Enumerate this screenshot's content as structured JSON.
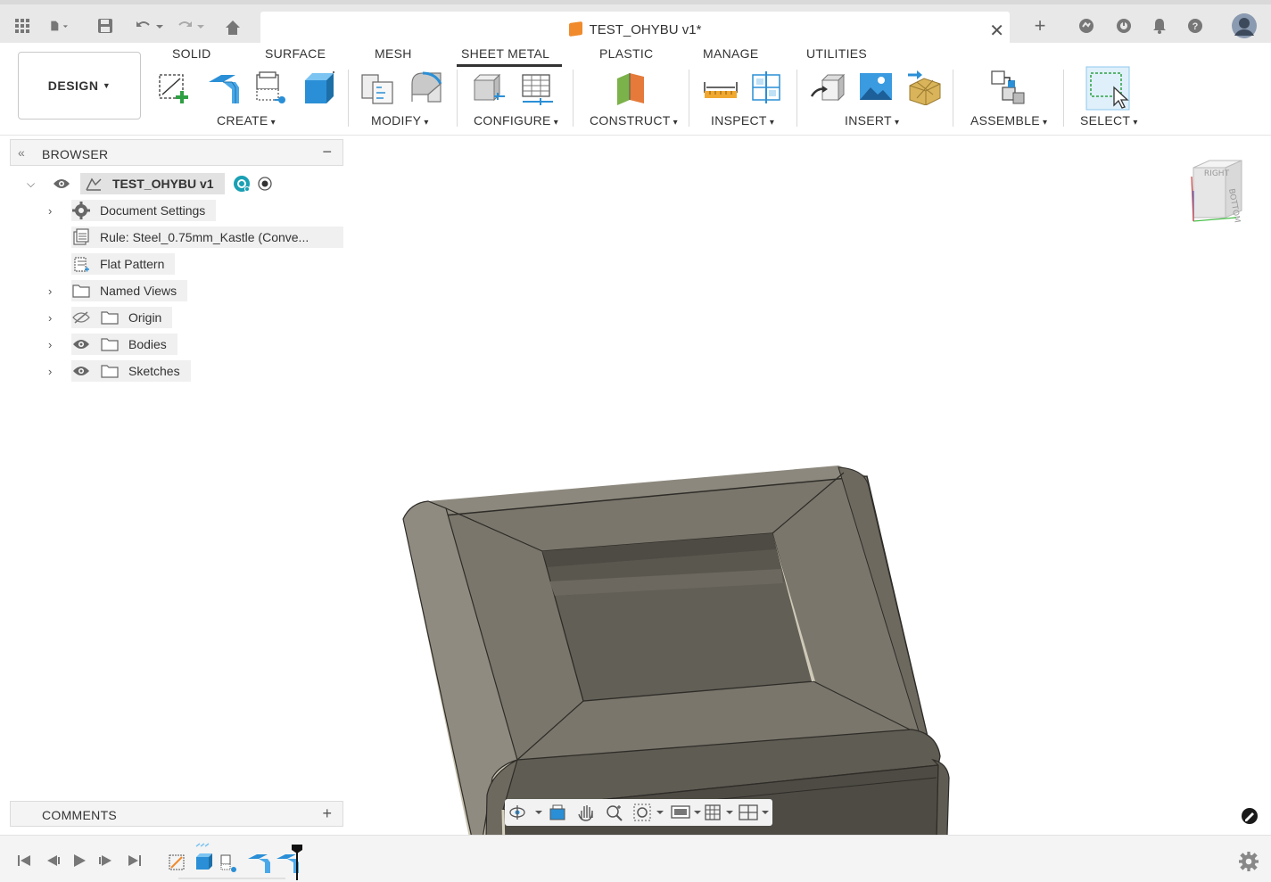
{
  "document": {
    "tab_title": "TEST_OHYBU v1*"
  },
  "toolbar": {
    "workspace_label": "DESIGN",
    "tabs": [
      "SOLID",
      "SURFACE",
      "MESH",
      "SHEET METAL",
      "PLASTIC",
      "MANAGE",
      "UTILITIES"
    ],
    "active_tab": "SHEET METAL",
    "groups": [
      "CREATE",
      "MODIFY",
      "CONFIGURE",
      "CONSTRUCT",
      "INSPECT",
      "INSERT",
      "ASSEMBLE",
      "SELECT"
    ]
  },
  "browser": {
    "title": "BROWSER",
    "root": "TEST_OHYBU v1",
    "items": [
      {
        "label": "Document Settings",
        "icon": "gear-icon"
      },
      {
        "label": "Rule: Steel_0.75mm_Kastle (Conve...",
        "icon": "rule-icon"
      },
      {
        "label": "Flat Pattern",
        "icon": "flat-pattern-icon"
      },
      {
        "label": "Named Views",
        "icon": "folder-icon"
      },
      {
        "label": "Origin",
        "icon": "folder-icon",
        "visibility": "hidden"
      },
      {
        "label": "Bodies",
        "icon": "folder-icon",
        "visibility": "visible"
      },
      {
        "label": "Sketches",
        "icon": "folder-icon",
        "visibility": "visible"
      }
    ]
  },
  "viewcube": {
    "faces": [
      "RIGHT",
      "BOTTOM"
    ]
  },
  "comments": {
    "title": "COMMENTS"
  },
  "colors": {
    "accent": "#0696d7",
    "model_top": "#7a766c",
    "model_side": "#4e4b44"
  }
}
